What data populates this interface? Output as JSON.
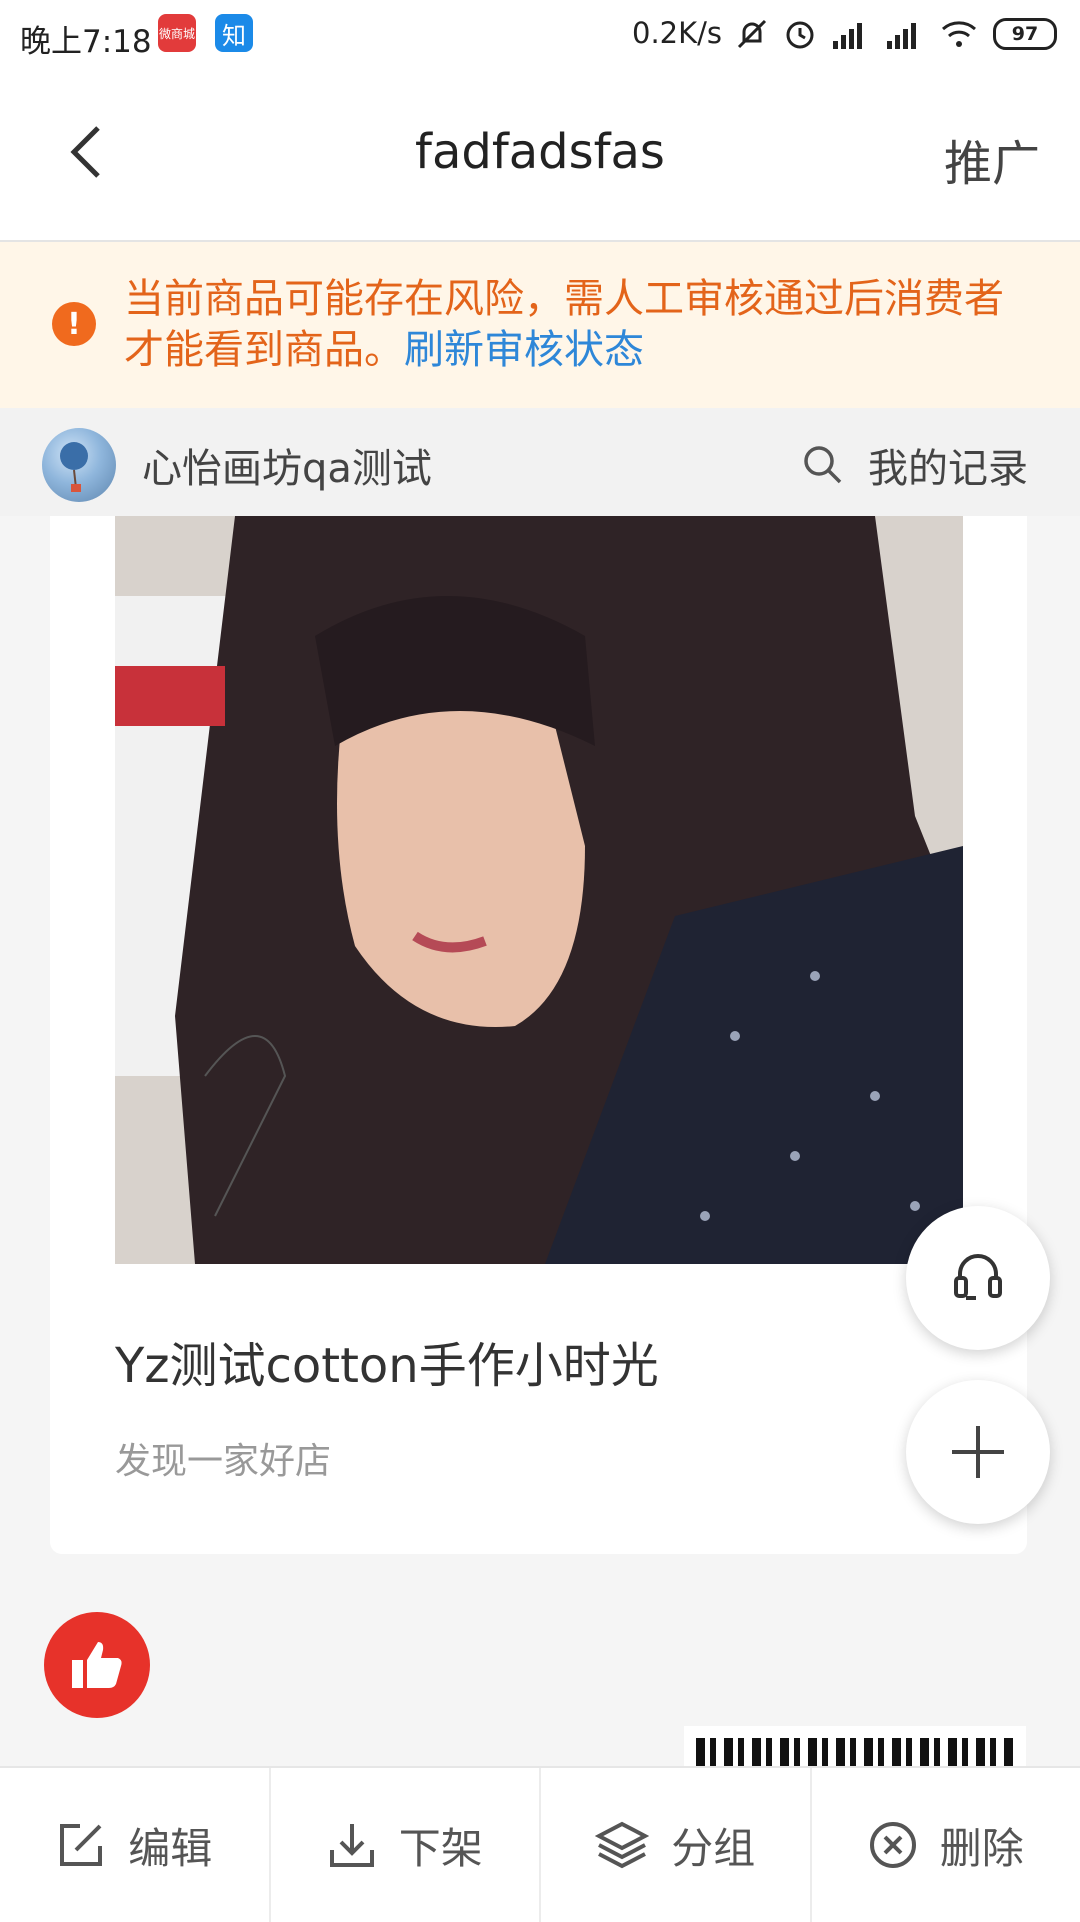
{
  "status_bar": {
    "time": "晚上7:18",
    "app_badge_1": "微商城",
    "app_badge_2": "知",
    "net_speed": "0.2K/s",
    "battery": "97"
  },
  "nav": {
    "title": "fadfadsfas",
    "right_action": "推广"
  },
  "warning": {
    "text": "当前商品可能存在风险，需人工审核通过后消费者才能看到商品。",
    "link": "刷新审核状态"
  },
  "shop": {
    "name": "心怡画坊qa测试",
    "records_label": "我的记录"
  },
  "card": {
    "title": "Yz测试cotton手作小时光",
    "subtitle": "发现一家好店"
  },
  "bottom_bar": {
    "items": [
      {
        "label": "编辑",
        "icon": "edit-icon"
      },
      {
        "label": "下架",
        "icon": "download-icon"
      },
      {
        "label": "分组",
        "icon": "layers-icon"
      },
      {
        "label": "删除",
        "icon": "delete-circle-icon"
      }
    ]
  },
  "colors": {
    "warning_text": "#e3641a",
    "link": "#2e87d8",
    "like": "#e7322a"
  }
}
